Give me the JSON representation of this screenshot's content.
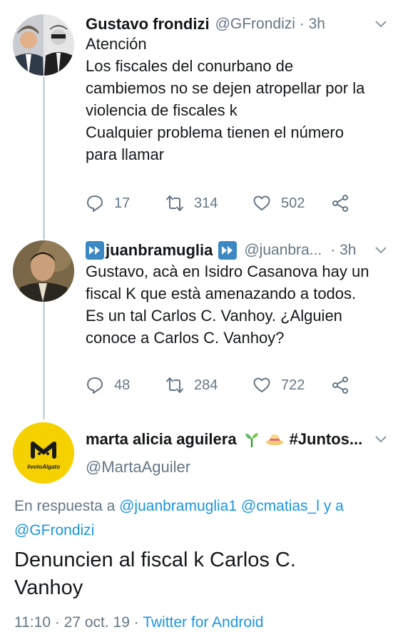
{
  "tweets": [
    {
      "display_name": "Gustavo frondizi",
      "handle_time": "@GFrondizi · 3h",
      "lines": [
        "Atención",
        "Los fiscales del conurbano de",
        "cambiemos no se dejen atropellar por la",
        "violencia de fiscales k",
        "Cualquier problema tienen el número",
        "para llamar"
      ],
      "replies": "17",
      "retweets": "314",
      "likes": "502"
    },
    {
      "display_name": "juanbramuglia",
      "handle": "@juanbra...",
      "time": "· 3h",
      "lines": [
        "Gustavo, acà en Isidro Casanova hay un",
        "fiscal K que està amenazando a todos.",
        "Es un tal Carlos C. Vanhoy. ¿Alguien",
        "conoce a Carlos C. Vanhoy?"
      ],
      "replies": "48",
      "retweets": "284",
      "likes": "722"
    }
  ],
  "main_tweet": {
    "display_name": "marta alicia aguilera",
    "hashtag": "#Juntos...",
    "handle": "@MartaAguiler",
    "avatar_letter": "M",
    "avatar_caption": "#votoAlgato",
    "reply_prefix": "En respuesta a",
    "reply_user1": "@juanbramuglia1",
    "reply_user2": "@cmatias_l",
    "reply_and": "y a",
    "reply_user3": "@GFrondizi",
    "text_line1": "Denuncien al fiscal k Carlos C.",
    "text_line2": "Vanhoy",
    "time_date": "11:10 · 27 oct. 19 ·",
    "source": "Twitter for Android"
  },
  "colors": {
    "link": "#1b95e0",
    "muted": "#657786",
    "text": "#14171a",
    "thread_line": "#ccd6dd",
    "verified_badge": "#3b88c3",
    "avatar_yellow": "#f5d100"
  },
  "icons": [
    "reply-icon",
    "retweet-icon",
    "like-icon",
    "share-icon",
    "chevron-down-icon",
    "fast-forward-icon",
    "seedling-icon",
    "hat-emoji-icon"
  ]
}
